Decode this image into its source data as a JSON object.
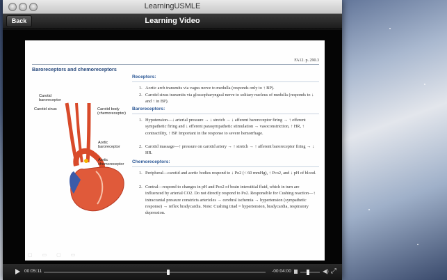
{
  "window": {
    "title": "LearningUSMLE"
  },
  "toolbar": {
    "back_label": "Back",
    "title": "Learning Video"
  },
  "slide": {
    "page_ref": "FA12. p. 290.3",
    "heading": "Baroreceptors and chemoreceptors",
    "figure_labels": {
      "carotid_baroreceptor": "Carotid baroreceptor",
      "carotid_sinus": "Carotid sinus",
      "carotid_body": "Carotid body (chemoreceptor)",
      "aortic_baroreceptor": "Aortic baroreceptor",
      "aortic_chemoreceptor": "Aortic chemoreceptor"
    },
    "receptors": {
      "title": "Receptors:",
      "items": [
        "Aortic arch transmits via vagus nerve to medulla (responds only to ↑ BP).",
        "Carotid sinus transmits via glossopharyngeal nerve to solitary nucleus of medulla (responds to ↓ and ↑ in BP)."
      ]
    },
    "baroreceptors": {
      "title": "Baroreceptors:",
      "items": [
        "Hypotension—↓ arterial pressure → ↓ stretch → ↓ afferent baroreceptor firing → ↑ efferent sympathetic firing and ↓ efferent parasympathetic stimulation → vasoconstriction, ↑ HR, ↑ contractility, ↑ BP. Important in the response to severe hemorrhage.",
        "Carotid massage—↑ pressure on carotid artery → ↑ stretch → ↑ afferent baroreceptor firing → ↓ HR."
      ]
    },
    "chemoreceptors": {
      "title": "Chemoreceptors:",
      "items": [
        "Peripheral—carotid and aortic bodies respond to ↓ Po2 (< 60 mmHg), ↑ Pco2, and ↓ pH of blood.",
        "Central—respond to changes in pH and Pco2 of brain interstitial fluid, which in turn are influenced by arterial CO2. Do not directly respond to Po2. Responsible for Cushing reaction—↑ intracranial pressure constricts arterioles → cerebral ischemia → hypertension (sympathetic response) → reflex bradycardia. Note: Cushing triad = hypertension, bradycardia, respiratory depression."
      ]
    }
  },
  "player": {
    "elapsed": "00:05:11",
    "remaining": "-00:04:00",
    "progress": 0.56,
    "volume": 0.4
  }
}
